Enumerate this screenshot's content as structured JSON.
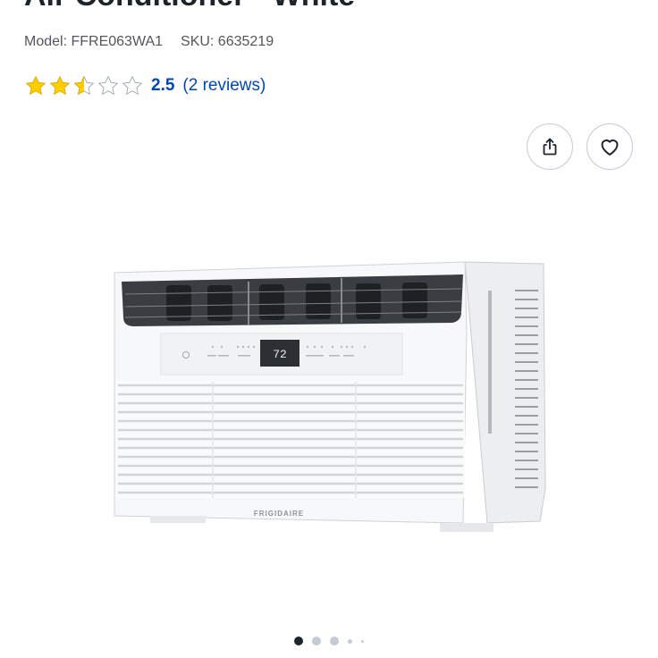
{
  "product": {
    "title": "Air Conditioner - White",
    "model": "Model: FFRE063WA1",
    "sku": "SKU: 6635219",
    "brand_text": "FRIGIDAIRE",
    "display_value": "72"
  },
  "rating": {
    "value": "2.5",
    "reviews": "(2 reviews)",
    "stars": 2.5,
    "max": 5,
    "star_color": "#ffce00"
  },
  "actions": {
    "share_icon": "share-icon",
    "favorite_icon": "heart-icon"
  },
  "carousel": {
    "total": 5,
    "active_index": 0
  },
  "colors": {
    "link": "#0046be",
    "text": "#1d252c"
  }
}
